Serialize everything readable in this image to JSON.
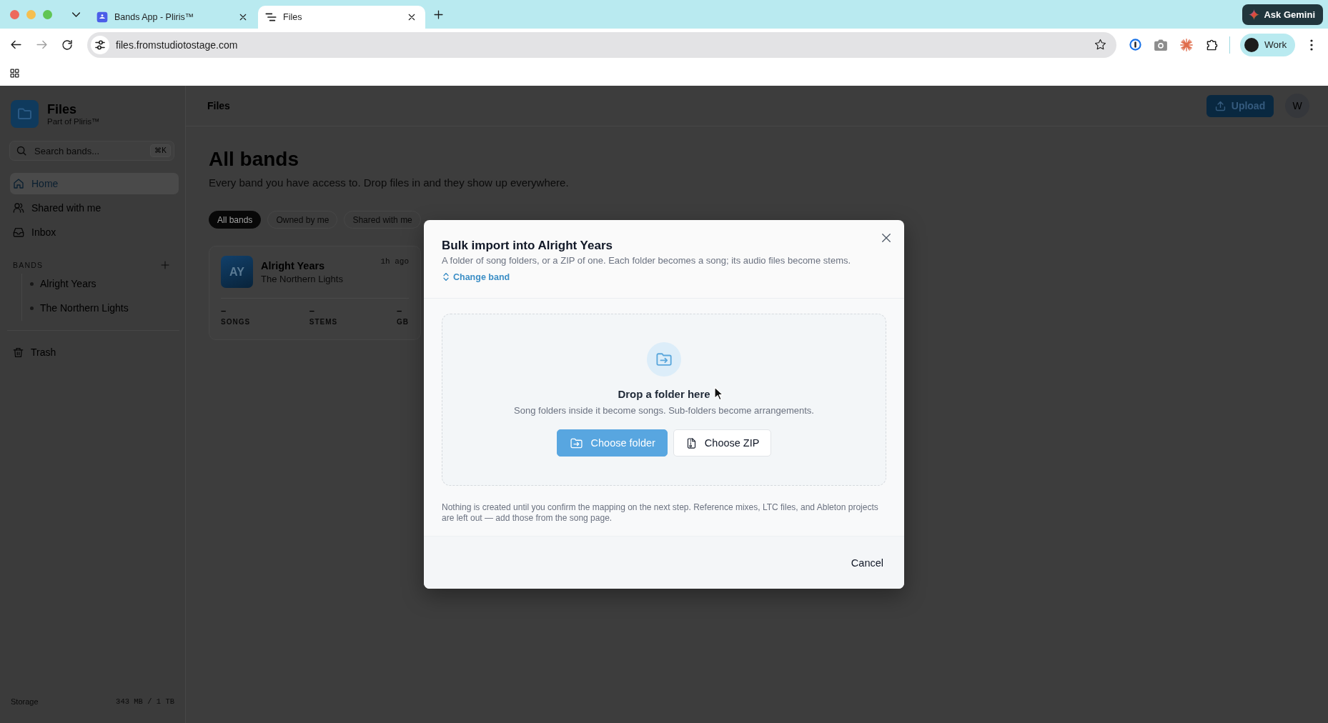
{
  "browser": {
    "tabs": [
      {
        "title": "Bands App - Pliris™",
        "kind": "app",
        "selected": false
      },
      {
        "title": "Files",
        "kind": "files",
        "selected": true
      }
    ],
    "url": "files.fromstudiotostage.com",
    "assistant_button": "Ask Gemini",
    "profile": "Work"
  },
  "sidebar": {
    "app_name": "Files",
    "app_tagline": "Part of Pliris™",
    "search": {
      "placeholder": "Search bands...",
      "shortcut": "⌘K"
    },
    "nav": [
      {
        "label": "Home",
        "kind": "home",
        "selected": true
      },
      {
        "label": "Shared with me",
        "kind": "people",
        "selected": false
      },
      {
        "label": "Inbox",
        "kind": "inbox",
        "selected": false
      }
    ],
    "bands_heading": "BANDS",
    "bands": [
      "Alright Years",
      "The Northern Lights"
    ],
    "trash": "Trash",
    "storage": {
      "label": "Storage",
      "value": "343 MB / 1 TB"
    }
  },
  "header": {
    "title": "Files",
    "upload_button": "Upload",
    "avatar": "W"
  },
  "main": {
    "title": "All bands",
    "subtitle": "Every band you have access to. Drop files in and they show up everywhere.",
    "filters": [
      {
        "label": "All bands",
        "selected": true
      },
      {
        "label": "Owned by me",
        "selected": false
      },
      {
        "label": "Shared with me",
        "selected": false
      }
    ],
    "cards": [
      {
        "initials": "AY",
        "name": "Alright Years",
        "owner": "The Northern Lights",
        "time": "1h ago",
        "stats": [
          {
            "value": "–",
            "label": "SONGS"
          },
          {
            "value": "–",
            "label": "STEMS"
          },
          {
            "value": "–",
            "label": "GB"
          }
        ]
      }
    ]
  },
  "dialog": {
    "title": "Bulk import into Alright Years",
    "description": "A folder of song folders, or a ZIP of one. Each folder becomes a song; its audio files become stems.",
    "change_link": "Change band",
    "drop_title": "Drop a folder here",
    "drop_hint": "Song folders inside it become songs. Sub-folders become arrangements.",
    "buttons": [
      {
        "label": "Choose folder",
        "kind": "primary"
      },
      {
        "label": "Choose ZIP",
        "kind": "secondary"
      }
    ],
    "note": "Nothing is created until you confirm the mapping on the next step. Reference mixes, LTC files, and Ableton projects are left out — add those from the song page.",
    "cancel": "Cancel"
  }
}
